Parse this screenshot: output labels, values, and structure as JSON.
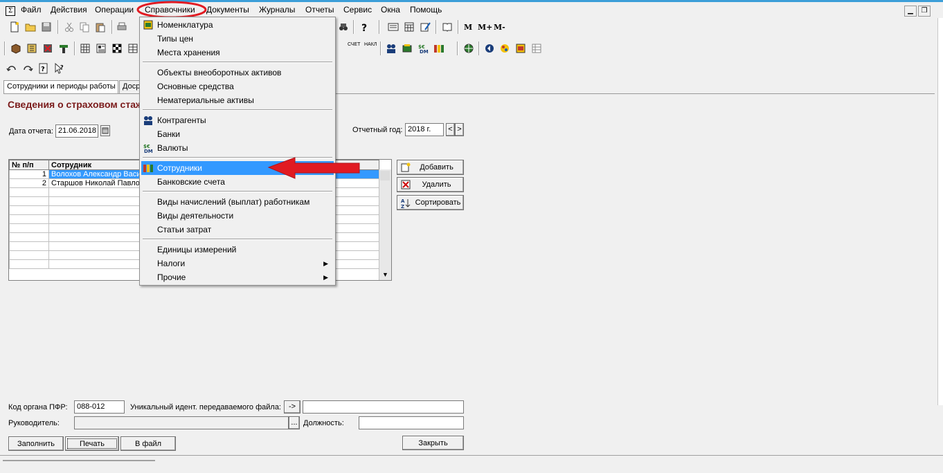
{
  "menubar": {
    "items": [
      "Файл",
      "Действия",
      "Операции",
      "Справочники",
      "Документы",
      "Журналы",
      "Отчеты",
      "Сервис",
      "Окна",
      "Помощь"
    ]
  },
  "toolbar": {
    "memory_buttons": [
      "M",
      "M+",
      "M-"
    ],
    "report_buttons": [
      "СЧЕТ",
      "НАКЛ"
    ]
  },
  "tabs": [
    "Сотрудники и периоды работы",
    "Досрочн"
  ],
  "form": {
    "title": "Сведения о страховом стаже",
    "report_date_label": "Дата отчета:",
    "report_date_value": "21.06.2018",
    "report_year_label": "Отчетный год:",
    "report_year_value": "2018 г.",
    "year_prev": "<",
    "year_next": ">"
  },
  "grid": {
    "columns": [
      "№ п/п",
      "Сотрудник"
    ],
    "rows": [
      {
        "num": "1",
        "name": "Волохов Александр Васильевич",
        "selected": true
      },
      {
        "num": "2",
        "name": "Старшов Николай Павлович",
        "selected": false
      }
    ]
  },
  "side_buttons": {
    "add": "Добавить",
    "delete": "Удалить",
    "sort": "Сортировать"
  },
  "footer_form": {
    "pfr_label": "Код органа ПФР:",
    "pfr_value": "088-012",
    "file_id_label": "Уникальный идент. передаваемого файла:",
    "file_id_button": "->",
    "head_label": "Руководитель:",
    "head_button": "...",
    "position_label": "Должность:",
    "fill_button": "Заполнить",
    "print_button": "Печать",
    "to_file_button": "В файл",
    "close_button": "Закрыть"
  },
  "dropdown": {
    "groups": [
      [
        "Номенклатура",
        "Типы цен",
        "Места хранения"
      ],
      [
        "Объекты внеоборотных активов",
        "Основные средства",
        "Нематериальные активы"
      ],
      [
        "Контрагенты",
        "Банки",
        "Валюты"
      ],
      [
        "Сотрудники",
        "Банковские счета"
      ],
      [
        "Виды начислений (выплат) работникам",
        "Виды деятельности",
        "Статьи затрат"
      ],
      [
        "Единицы измерений",
        "Налоги",
        "Прочие"
      ]
    ]
  },
  "colors": {
    "highlight": "#3399ff",
    "title": "#7a1a1a",
    "annotation_red": "#e11b22"
  }
}
